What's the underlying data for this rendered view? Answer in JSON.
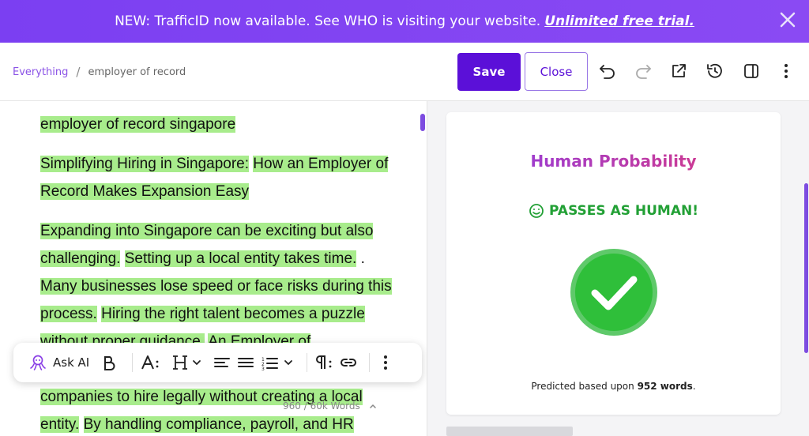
{
  "banner": {
    "text": "NEW: TrafficID now available. See WHO is visiting your website.",
    "link": "Unlimited free trial."
  },
  "breadcrumb": {
    "root": "Everything",
    "separator": "/",
    "current": "employer of record"
  },
  "toolbar_top": {
    "save_label": "Save",
    "close_label": "Close"
  },
  "editor": {
    "p1": "employer of record singapore",
    "p2a": "Simplifying Hiring in Singapore:",
    "p2b": "How an Employer of Record Makes Expansion Easy",
    "p3a": "Expanding into Singapore can be exciting but also challenging.",
    "p3b": "Setting up a local entity takes time.",
    "p3c": " .",
    "p3d": "Many businesses lose speed or face risks during this process.",
    "p3e": "Hiring the right talent becomes a puzzle without proper guidance.",
    "p3f": "An Employer of",
    "p3g": "companies to hire legally without creating a local entity.",
    "p3h": "By handling compliance, payroll, and HR"
  },
  "format_toolbar": {
    "ask_ai": "Ask AI",
    "word_count": "960 / 60k Words"
  },
  "panel": {
    "title": "Human Probability",
    "verdict": "PASSES AS HUMAN!",
    "predicted_prefix": "Predicted based upon ",
    "predicted_count": "952 words",
    "predicted_suffix": "."
  },
  "colors": {
    "accent": "#5b10d8",
    "highlight": "#a8ec8c",
    "pass": "#22a035",
    "check": "#2fbf3a"
  }
}
